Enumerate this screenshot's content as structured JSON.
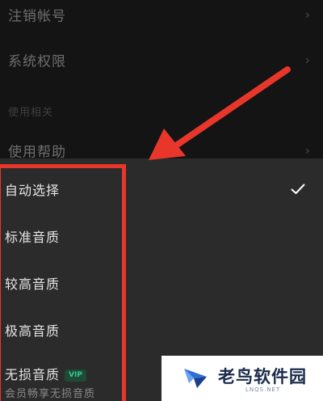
{
  "settings": {
    "items": [
      {
        "label": "注销帐号",
        "chevron": "›"
      },
      {
        "label": "系统权限",
        "chevron": "›"
      },
      {
        "label": "使用帮助",
        "chevron": "›"
      }
    ],
    "section_header": "使用相关"
  },
  "quality_sheet": {
    "options": [
      {
        "label": "自动选择",
        "selected": true
      },
      {
        "label": "标准音质",
        "selected": false
      },
      {
        "label": "较高音质",
        "selected": false
      },
      {
        "label": "极高音质",
        "selected": false
      },
      {
        "label": "无损音质",
        "selected": false,
        "badge": "VIP"
      }
    ],
    "lossless_note": "会员畅享无损音质",
    "check_icon": "checkmark-icon"
  },
  "annotation": {
    "color": "#e8372a",
    "arrow_icon": "arrow-icon"
  },
  "watermark": {
    "name": "老鸟软件园",
    "url": "LNQS.NET",
    "logo_icon": "bird-logo-icon"
  }
}
